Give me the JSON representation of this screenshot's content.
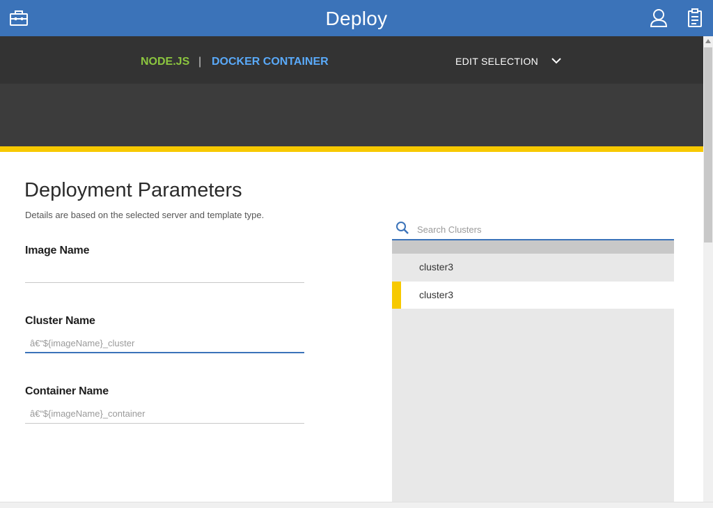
{
  "app": {
    "title": "Deploy",
    "icons": {
      "left": "toolbox-icon",
      "user": "user-icon",
      "clipboard": "clipboard-icon"
    }
  },
  "breadcrumb": {
    "items": [
      "NODE.JS",
      "DOCKER CONTAINER"
    ],
    "separator": "|",
    "edit_label": "EDIT SELECTION"
  },
  "form": {
    "title": "Deployment Parameters",
    "description": "Details are based on the selected server and template type.",
    "fields": [
      {
        "label": "Image Name",
        "value": "",
        "placeholder": ""
      },
      {
        "label": "Cluster Name",
        "value": "",
        "placeholder": "â€“${imageName}_cluster"
      },
      {
        "label": "Container Name",
        "value": "",
        "placeholder": "â€“${imageName}_container"
      }
    ]
  },
  "clusters": {
    "search_placeholder": "Search Clusters",
    "items": [
      {
        "name": "cluster3",
        "selected": false
      },
      {
        "name": "cluster3",
        "selected": true
      }
    ]
  },
  "colors": {
    "header_blue": "#3b73b9",
    "accent_yellow": "#f7c900",
    "node_green": "#8cc63f",
    "docker_blue": "#5aaafa"
  }
}
